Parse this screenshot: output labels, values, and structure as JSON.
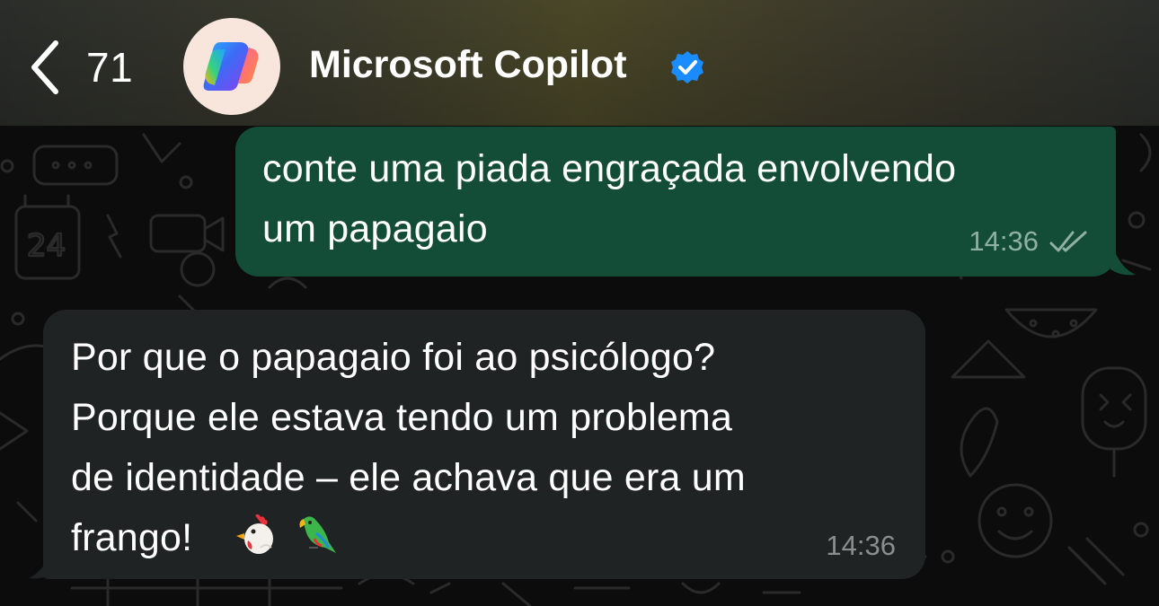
{
  "header": {
    "back_count": "71",
    "contact_name": "Microsoft Copilot",
    "avatar_icon": "copilot-logo-icon",
    "verified_icon": "verified-badge-icon"
  },
  "messages": [
    {
      "direction": "outgoing",
      "lines": [
        "conte uma piada engraçada envolvendo",
        "um papagaio"
      ],
      "time": "14:36",
      "status_icon": "double-check-read-icon"
    },
    {
      "direction": "incoming",
      "lines": [
        "Por que o papagaio foi ao psicólogo?",
        "Porque ele estava tendo um problema",
        "de identidade – ele achava que era um",
        "frango!"
      ],
      "emojis": [
        "rooster-emoji",
        "parrot-emoji"
      ],
      "time": "14:36"
    }
  ],
  "colors": {
    "outgoing_bubble": "#144d37",
    "incoming_bubble": "#1f2323",
    "verified_badge": "#1a8cff",
    "background": "#0c0c0c"
  }
}
